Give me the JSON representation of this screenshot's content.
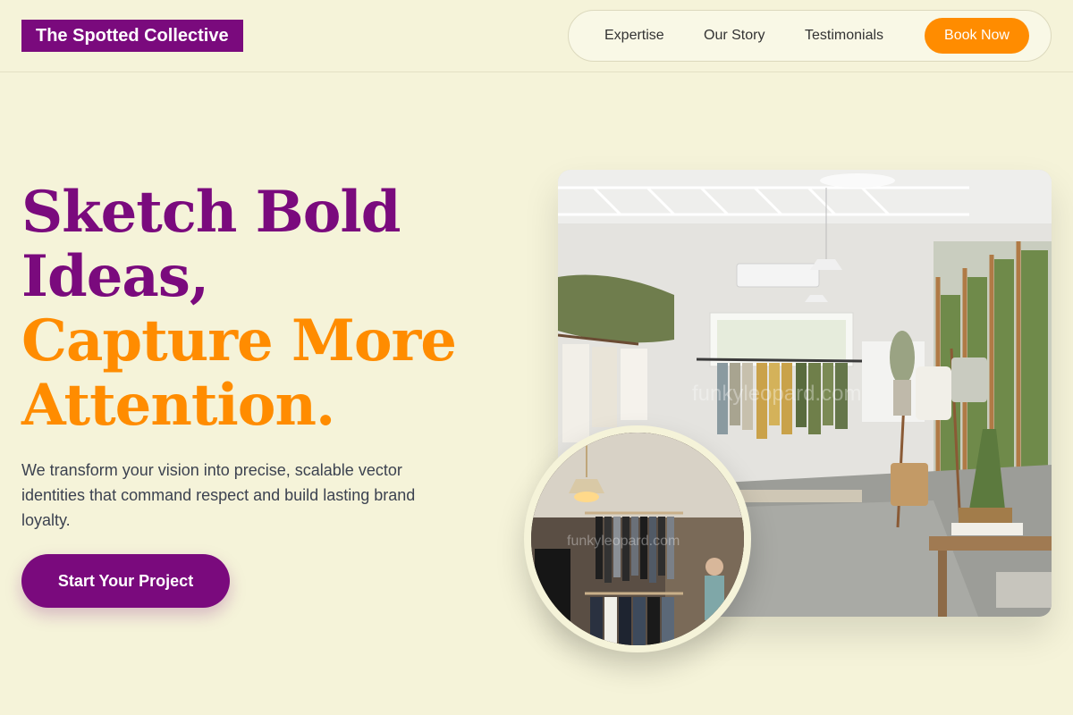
{
  "brand": {
    "name": "The Spotted Collective"
  },
  "nav": {
    "links": [
      "Expertise",
      "Our Story",
      "Testimonials"
    ],
    "cta_label": "Book Now"
  },
  "hero": {
    "headline_purple": "Sketch Bold Ideas,",
    "headline_orange": "Capture More Attention.",
    "description": "We transform your vision into precise, scalable vector identities that command respect and build lasting brand loyalty.",
    "cta_label": "Start Your Project"
  },
  "images": {
    "main": {
      "description": "Bright clothing boutique interior with hanging garments, plants and large windows"
    },
    "inset": {
      "description": "Dim boutique rack of dark clothing lit by a pendant lamp"
    }
  },
  "colors": {
    "background": "#f5f3d9",
    "brand_purple": "#7a0a7d",
    "accent_orange": "#ff8c00",
    "body_text": "#3c4250"
  }
}
